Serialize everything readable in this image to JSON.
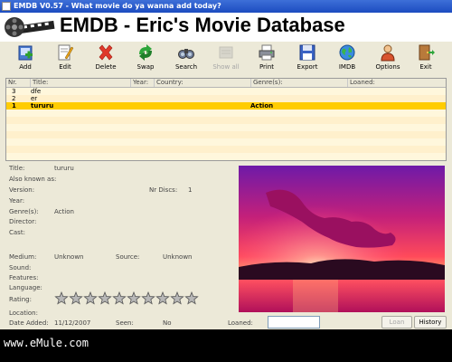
{
  "window": {
    "title": "EMDB V0.57 - What movie do ya wanna add today?"
  },
  "banner": {
    "title": "EMDB - Eric's Movie Database"
  },
  "toolbar": {
    "add": "Add",
    "edit": "Edit",
    "delete": "Delete",
    "swap": "Swap",
    "search": "Search",
    "show_all": "Show all",
    "print": "Print",
    "export": "Export",
    "imdb": "IMDB",
    "options": "Options",
    "exit": "Exit"
  },
  "list": {
    "headers": {
      "nr": "Nr.",
      "title": "Title:",
      "year": "Year:",
      "country": "Country:",
      "genres": "Genre(s):",
      "loaned": "Loaned:"
    },
    "rows": [
      {
        "nr": "3",
        "title": "dfe",
        "genre": ""
      },
      {
        "nr": "2",
        "title": "er",
        "genre": ""
      },
      {
        "nr": "1",
        "title": "tururu",
        "genre": "Action"
      }
    ]
  },
  "details": {
    "labels": {
      "title": "Title:",
      "aka": "Also known as:",
      "version": "Version:",
      "year": "Year:",
      "genres": "Genre(s):",
      "director": "Director:",
      "cast": "Cast:",
      "nr_discs": "Nr Discs:",
      "medium": "Medium:",
      "source": "Source:",
      "sound": "Sound:",
      "features": "Features:",
      "language": "Language:",
      "rating": "Rating:",
      "location": "Location:",
      "date_added": "Date Added:",
      "seen": "Seen:",
      "loaned": "Loaned:"
    },
    "values": {
      "title": "tururu",
      "nr_discs": "1",
      "genres": "Action",
      "medium": "Unknown",
      "source": "Unknown",
      "date_added": "11/12/2007",
      "seen": "No"
    },
    "rating_stars": 10
  },
  "buttons": {
    "loan": "Loan",
    "history": "History"
  },
  "footer": {
    "watermark": "www.eMule.com"
  }
}
